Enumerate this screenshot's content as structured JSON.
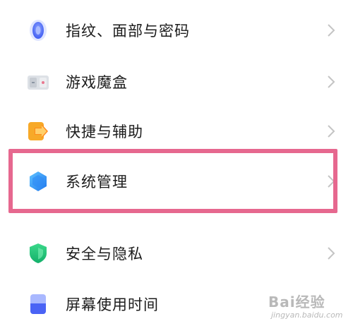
{
  "settings": {
    "items": [
      {
        "label": "指纹、面部与密码",
        "icon": "fingerprint-icon"
      },
      {
        "label": "游戏魔盒",
        "icon": "game-box-icon"
      },
      {
        "label": "快捷与辅助",
        "icon": "shortcut-icon"
      },
      {
        "label": "系统管理",
        "icon": "system-hexagon-icon"
      },
      {
        "label": "安全与隐私",
        "icon": "shield-icon"
      },
      {
        "label": "屏幕使用时间",
        "icon": "screen-time-icon"
      }
    ]
  },
  "watermark": {
    "logo": "Bai经验",
    "url": "jingyan.baidu.com"
  },
  "colors": {
    "highlight": "#e6688f",
    "chevron": "#c4c4c4",
    "text": "#1c1c1c"
  }
}
